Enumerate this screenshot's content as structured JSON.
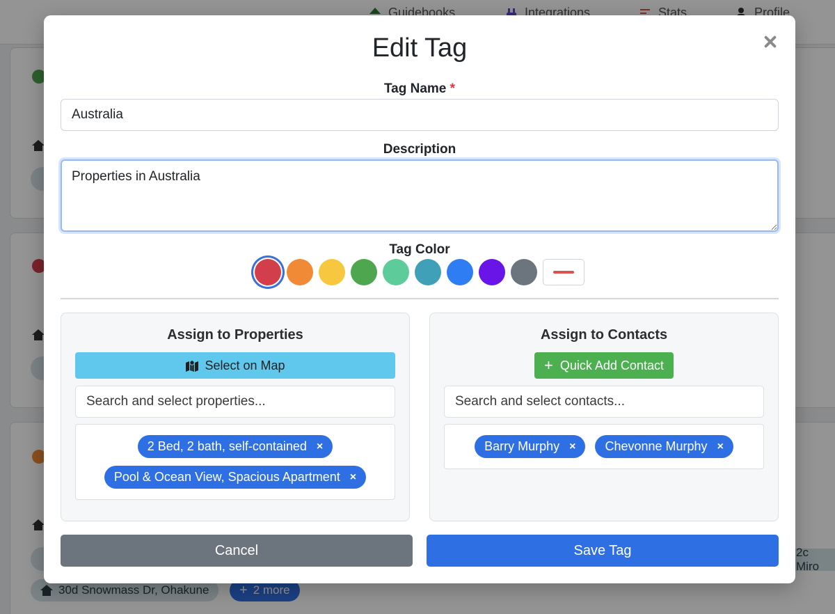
{
  "background": {
    "nav": [
      {
        "label": "Guidebooks",
        "icon": "guidebook-icon",
        "color": "#2e7d32"
      },
      {
        "label": "Integrations",
        "icon": "plug-icon",
        "color": "#5a4fcf"
      },
      {
        "label": "Stats",
        "icon": "stats-icon",
        "color": "#d9534f"
      },
      {
        "label": "Profile",
        "icon": "person-icon",
        "color": "#333333"
      }
    ],
    "pill_address": "30d Snowmass Dr, Ohakune",
    "pill_more": "2 more",
    "pill_right": "2c Miro"
  },
  "modal": {
    "title": "Edit Tag",
    "tag_name_label": "Tag Name",
    "required_mark": "*",
    "tag_name_value": "Australia",
    "description_label": "Description",
    "description_value": "Properties in Australia",
    "tag_color_label": "Tag Color",
    "colors": [
      "#d23f4b",
      "#f08a36",
      "#f7c83f",
      "#4ea64f",
      "#5ecb9a",
      "#3fa0b8",
      "#2f7df2",
      "#6a15e8",
      "#6c757d"
    ],
    "selected_color": "#d23f4b",
    "properties": {
      "title": "Assign to Properties",
      "button_label": "Select on Map",
      "search_placeholder": "Search and select properties...",
      "selected": [
        "2 Bed, 2 bath, self-contained",
        "Pool & Ocean View, Spacious Apartment"
      ]
    },
    "contacts": {
      "title": "Assign to Contacts",
      "button_label": "Quick Add Contact",
      "search_placeholder": "Search and select contacts...",
      "selected": [
        "Barry Murphy",
        "Chevonne Murphy"
      ]
    },
    "chip_remove": "×",
    "cancel_label": "Cancel",
    "save_label": "Save Tag"
  }
}
